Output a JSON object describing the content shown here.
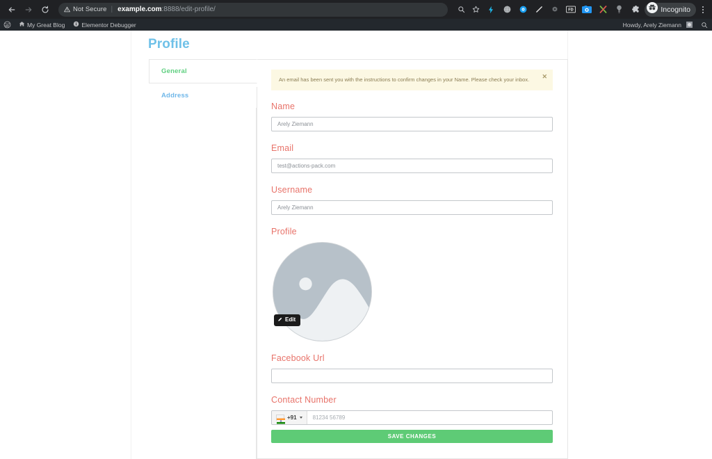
{
  "browser": {
    "back_icon": "arrow-left-icon",
    "forward_icon": "arrow-right-icon",
    "reload_icon": "reload-icon",
    "security_warning_icon": "warning-triangle-icon",
    "security_label": "Not Secure",
    "url_host": "example.com",
    "url_rest": ":8888/edit-profile/",
    "search_icon": "search-icon",
    "bookmark_icon": "star-icon",
    "extensions": [
      {
        "name": "lightning-bolt-icon",
        "color": "#1fb6e8"
      },
      {
        "name": "globe-grid-icon",
        "color": "#b5b8bb"
      },
      {
        "name": "blue-eye-icon",
        "color": "#1a9ff0"
      },
      {
        "name": "pen-icon",
        "color": "#e8e8e8"
      },
      {
        "name": "gear-dark-icon",
        "color": "#6f7377"
      },
      {
        "name": "fd-badge-icon",
        "color": "#ffffff"
      },
      {
        "name": "camera-badge-icon",
        "color": "#2196f3"
      },
      {
        "name": "x-cross-icon",
        "color": "#7bb842"
      },
      {
        "name": "lightbulb-icon",
        "color": "#8e9296"
      },
      {
        "name": "puzzle-piece-icon",
        "color": "#c9ccd0"
      }
    ],
    "incognito_icon": "incognito-avatar-icon",
    "incognito_label": "Incognito",
    "menu_icon": "kebab-menu-icon"
  },
  "adminbar": {
    "wp_logo_icon": "wordpress-logo-icon",
    "site_icon": "house-icon",
    "site_name": "My Great Blog",
    "debugger_icon": "info-circle-icon",
    "debugger_label": "Elementor Debugger",
    "howdy": "Howdy, Arely Ziemann",
    "avatar_icon": "user-avatar-icon",
    "search_icon": "search-icon"
  },
  "page": {
    "title": "Profile",
    "title_color": "#6fc1e8"
  },
  "tabs": [
    {
      "label": "General",
      "active": true,
      "color": "#5fcf80"
    },
    {
      "label": "Address",
      "active": false,
      "color": "#6fb7e9"
    }
  ],
  "notice": {
    "text": "An email has been sent you with the instructions to confirm changes in your Name. Please check your inbox.",
    "close_icon": "close-x-icon",
    "background": "#fcf8e3",
    "text_color": "#8a7c52"
  },
  "form": {
    "label_color": "#e8736a",
    "name": {
      "label": "Name",
      "value": "Arely Ziemann",
      "placeholder": "Name"
    },
    "email": {
      "label": "Email",
      "value": "test@actions-pack.com",
      "placeholder": "Email"
    },
    "username": {
      "label": "Username",
      "value": "Arely Ziemann",
      "placeholder": "Username"
    },
    "profile_photo": {
      "label": "Profile",
      "edit_label": "Edit",
      "edit_icon": "pencil-icon",
      "image_icon": "image-placeholder-icon"
    },
    "facebook_url": {
      "label": "Facebook Url",
      "value": "",
      "placeholder": ""
    },
    "contact_number": {
      "label": "Contact Number",
      "dial_code": "+91",
      "flag_icon": "india-flag-icon",
      "caret_icon": "chevron-down-icon",
      "placeholder": "81234 56789",
      "value": ""
    },
    "save_label": "SAVE CHANGES",
    "save_color": "#5ecb76"
  }
}
